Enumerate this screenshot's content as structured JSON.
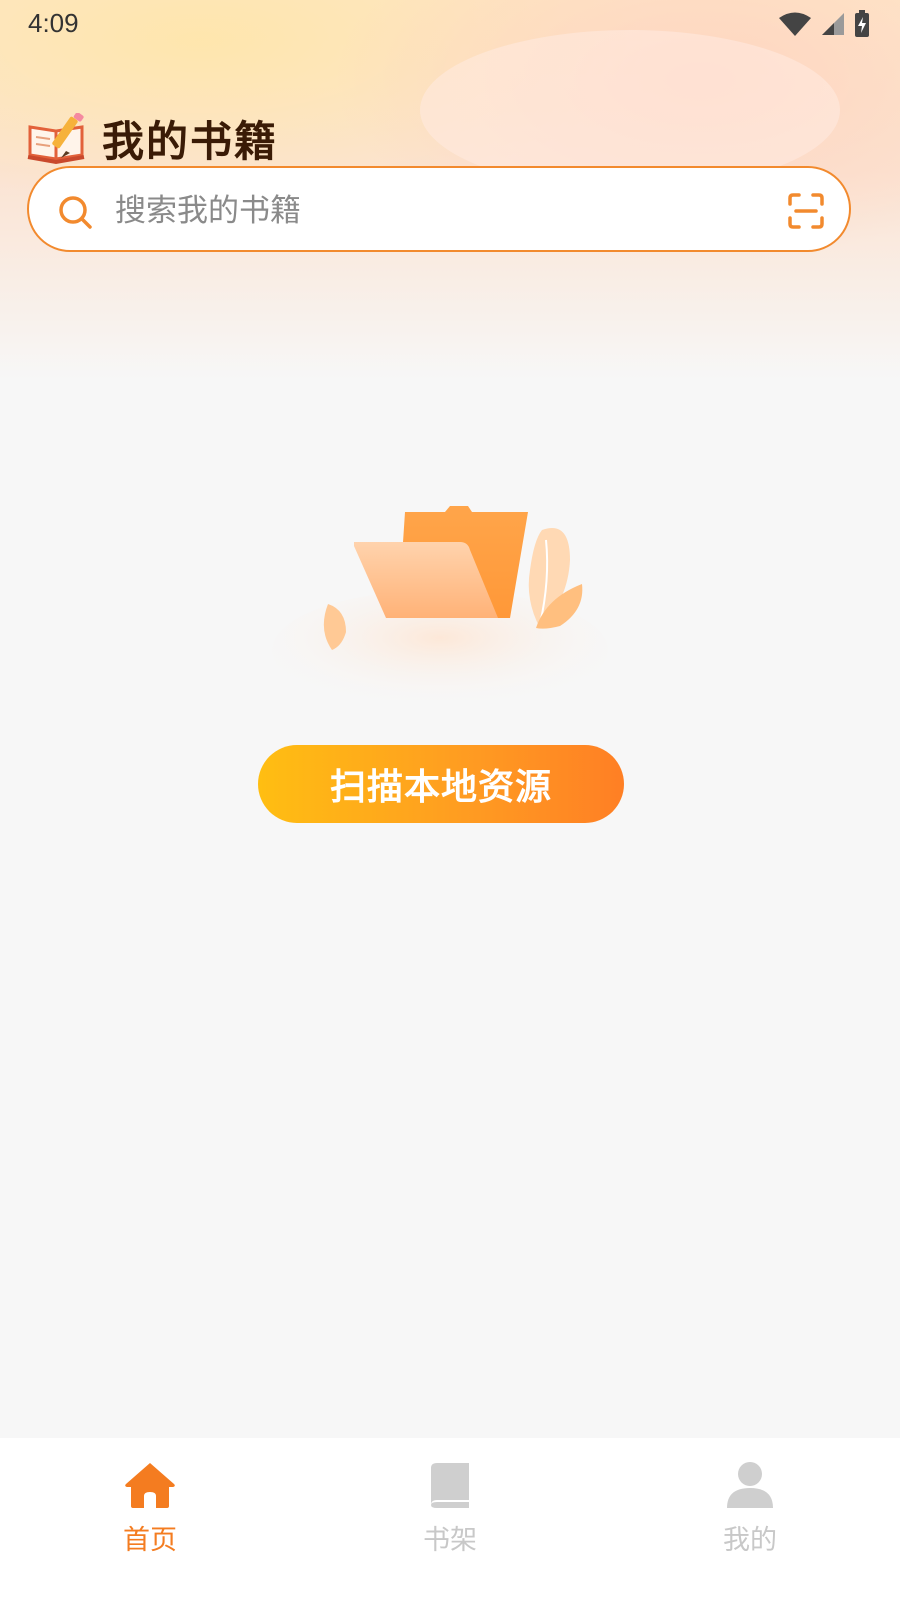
{
  "status_bar": {
    "time": "4:09"
  },
  "header": {
    "title": "我的书籍",
    "icon": "book-pencil-icon"
  },
  "search": {
    "placeholder": "搜索我的书籍",
    "value": ""
  },
  "empty_state": {
    "illustration": "folder-illustration",
    "button_label": "扫描本地资源"
  },
  "tab_bar": {
    "items": [
      {
        "label": "首页",
        "icon": "home-icon",
        "active": true
      },
      {
        "label": "书架",
        "icon": "bookshelf-icon",
        "active": false
      },
      {
        "label": "我的",
        "icon": "user-icon",
        "active": false
      }
    ]
  },
  "colors": {
    "accent": "#f47c20",
    "title": "#3a1b06",
    "button_start": "#ffbe12",
    "button_end": "#ff7f24"
  }
}
